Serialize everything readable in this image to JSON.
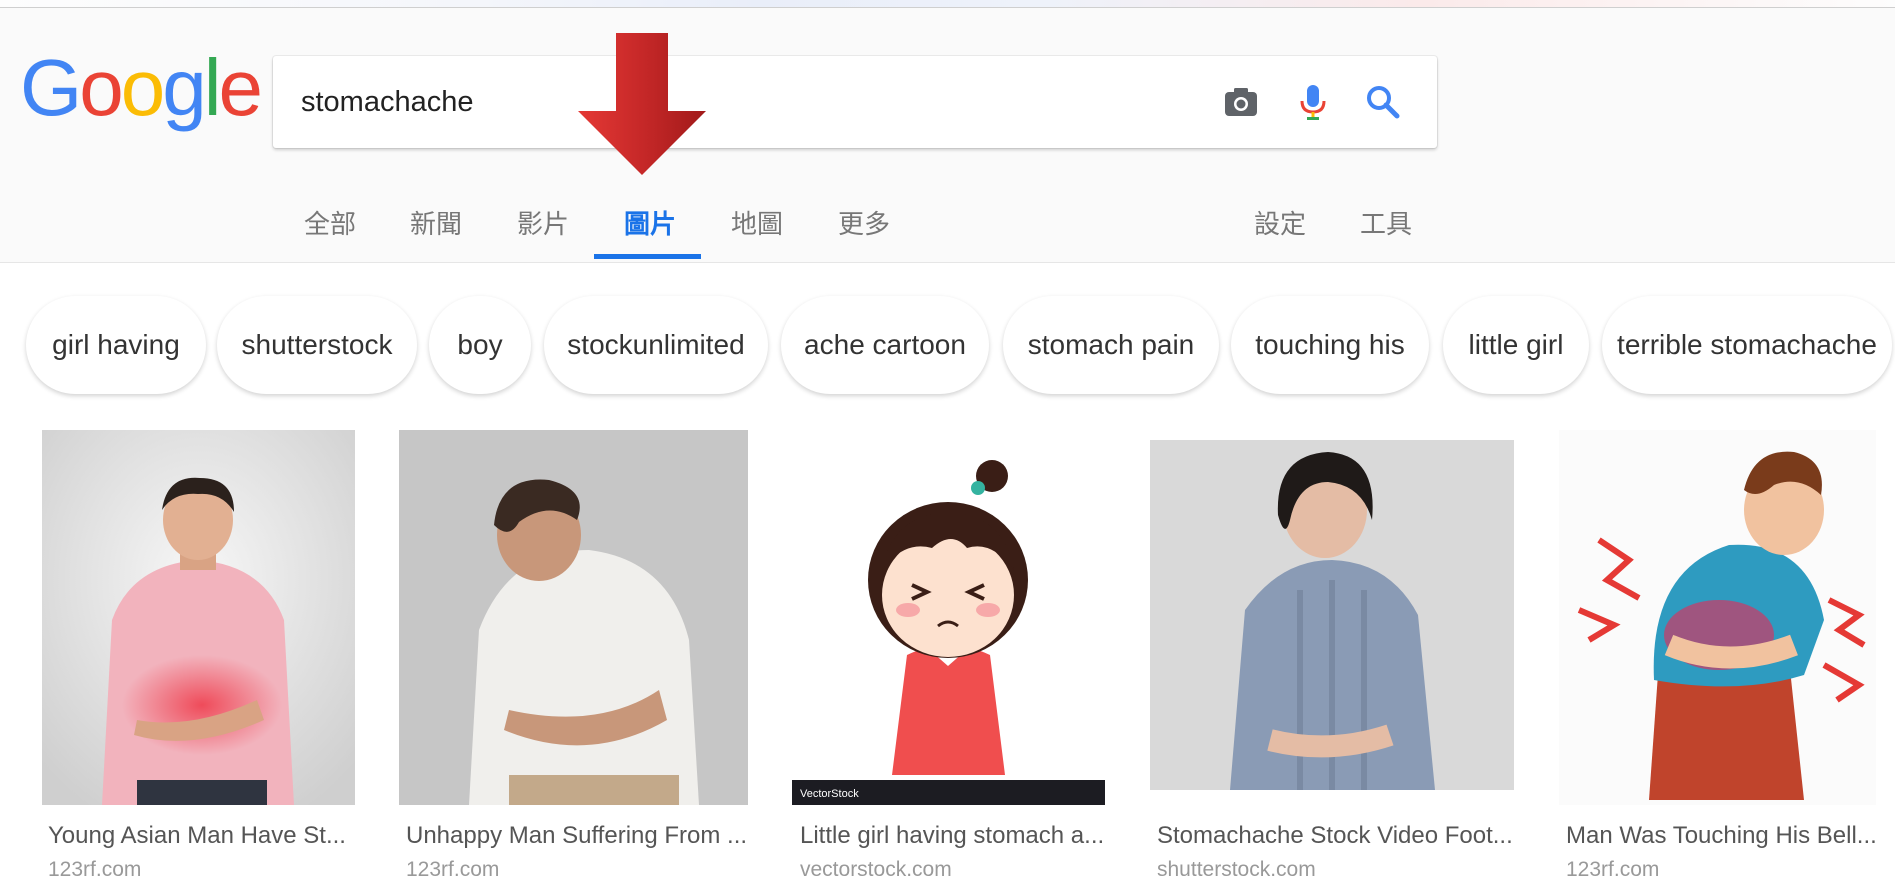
{
  "logo": {
    "letters": [
      "G",
      "o",
      "o",
      "g",
      "l",
      "e"
    ],
    "colors": [
      "#4285F4",
      "#EA4335",
      "#FBBC05",
      "#4285F4",
      "#34A853",
      "#EA4335"
    ]
  },
  "search": {
    "query": "stomachache"
  },
  "icons": {
    "camera": "camera-icon",
    "mic": "microphone-icon",
    "search": "search-icon"
  },
  "tabs": {
    "all": "全部",
    "news": "新聞",
    "videos": "影片",
    "images": "圖片",
    "maps": "地圖",
    "more": "更多",
    "settings": "設定",
    "tools": "工具"
  },
  "active_tab": "images",
  "chips": [
    "girl having",
    "shutterstock",
    "boy",
    "stockunlimited",
    "ache cartoon",
    "stomach pain",
    "touching his",
    "little girl",
    "terrible stomachache"
  ],
  "results": [
    {
      "title": "Young Asian Man Have St...",
      "source": "123rf.com"
    },
    {
      "title": "Unhappy Man Suffering From ...",
      "source": "123rf.com"
    },
    {
      "title": "Little girl having stomach a...",
      "source": "vectorstock.com",
      "watermark": "VectorStock"
    },
    {
      "title": "Stomachache Stock Video Foot...",
      "source": "shutterstock.com"
    },
    {
      "title": "Man Was Touching His Bell...",
      "source": "123rf.com"
    }
  ],
  "colors": {
    "accent": "#1a73e8",
    "arrow": "#c62828"
  }
}
